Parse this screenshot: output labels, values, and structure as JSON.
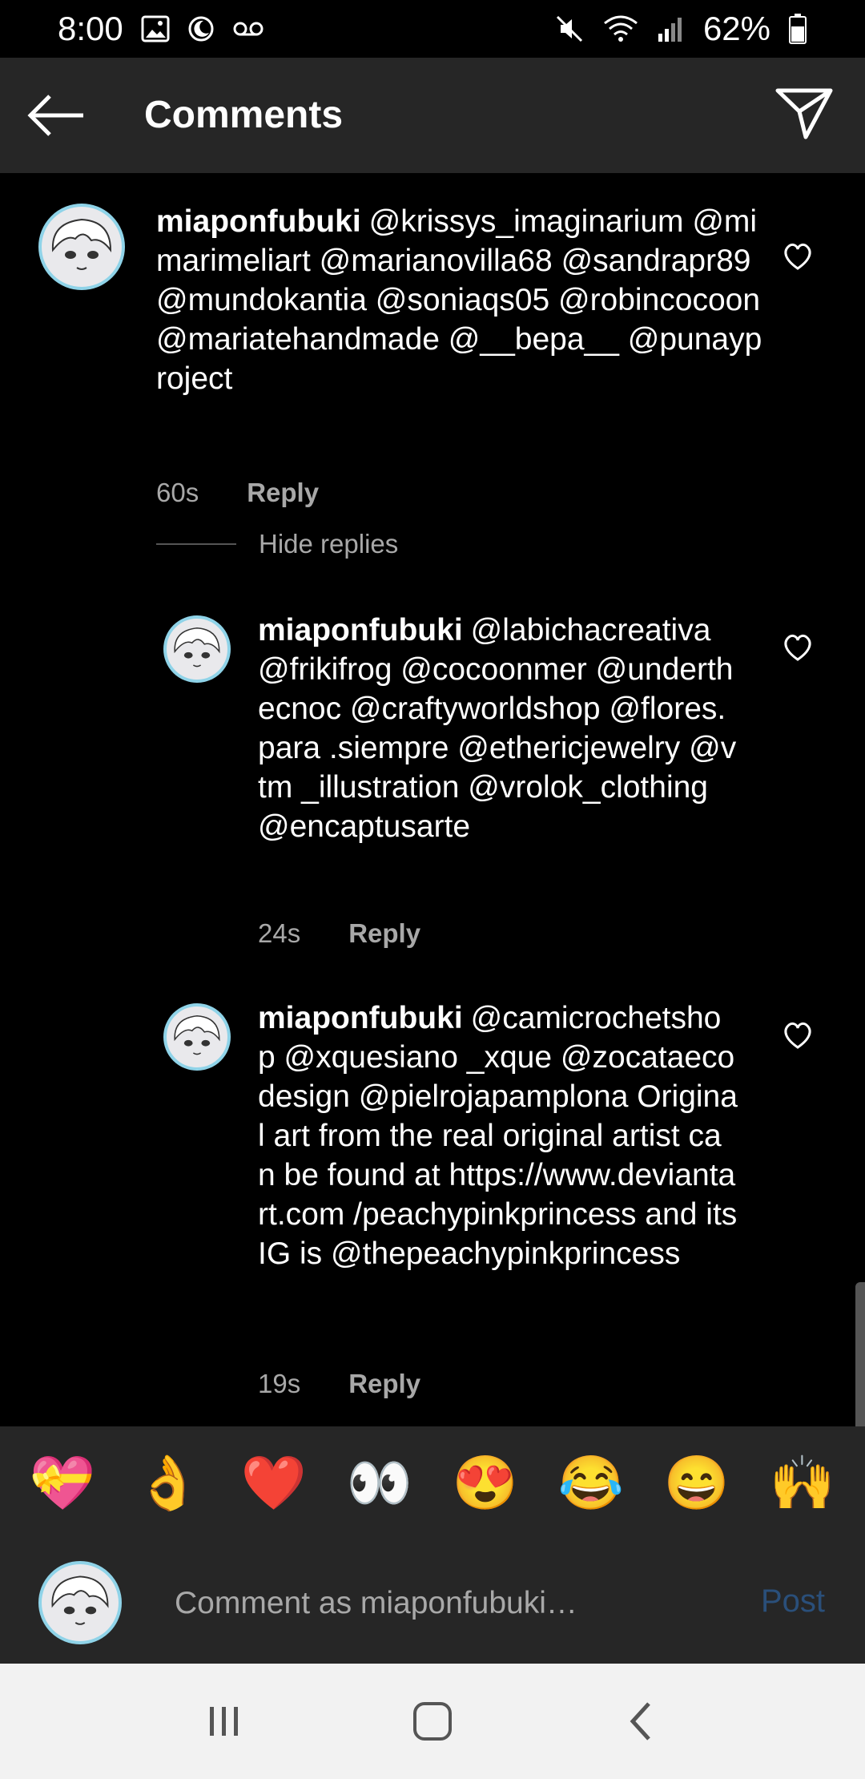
{
  "status_bar": {
    "time": "8:00",
    "battery": "62%",
    "icons_left": [
      "image-icon",
      "moon-icon",
      "voicemail-icon"
    ],
    "icons_right": [
      "mute-icon",
      "wifi-icon",
      "signal-icon",
      "battery-icon"
    ]
  },
  "header": {
    "title": "Comments",
    "back_icon": "arrow-left-icon",
    "share_icon": "send-icon"
  },
  "comments": [
    {
      "username": "miaponfubuki",
      "text": "@krissys_imaginarium @mimarimeliart @marianovilla68 @sandrapr89 @mundokantia @soniaqs05 @robincocoon @mariatehandmade @__bepa__ @punayproject",
      "time": "60s",
      "reply_label": "Reply"
    }
  ],
  "hide_replies_label": "Hide replies",
  "replies": [
    {
      "username": "miaponfubuki",
      "text": "@labichacreativa @frikifrog @cocoonmer @underthecnoc @craftyworldshop @flores.para .siempre @ethericjewelry @vtm _illustration @vrolok_clothing @encaptusarte",
      "time": "24s",
      "reply_label": "Reply"
    },
    {
      "username": "miaponfubuki",
      "text": "@camicrochetshop @xquesiano _xque @zocataecodesign @pielrojapamplona Original art from the real original artist can be found at https://www.deviantart.com /peachypinkprincess and its IG is @thepeachypinkprincess",
      "time": "19s",
      "reply_label": "Reply"
    }
  ],
  "emoji_bar": [
    "💝",
    "👌",
    "❤️",
    "👀",
    "😍",
    "😂",
    "😄",
    "🙌"
  ],
  "composer": {
    "placeholder": "Comment as miaponfubuki…",
    "post_label": "Post"
  },
  "nav": [
    "recents-icon",
    "home-icon",
    "back-icon"
  ]
}
